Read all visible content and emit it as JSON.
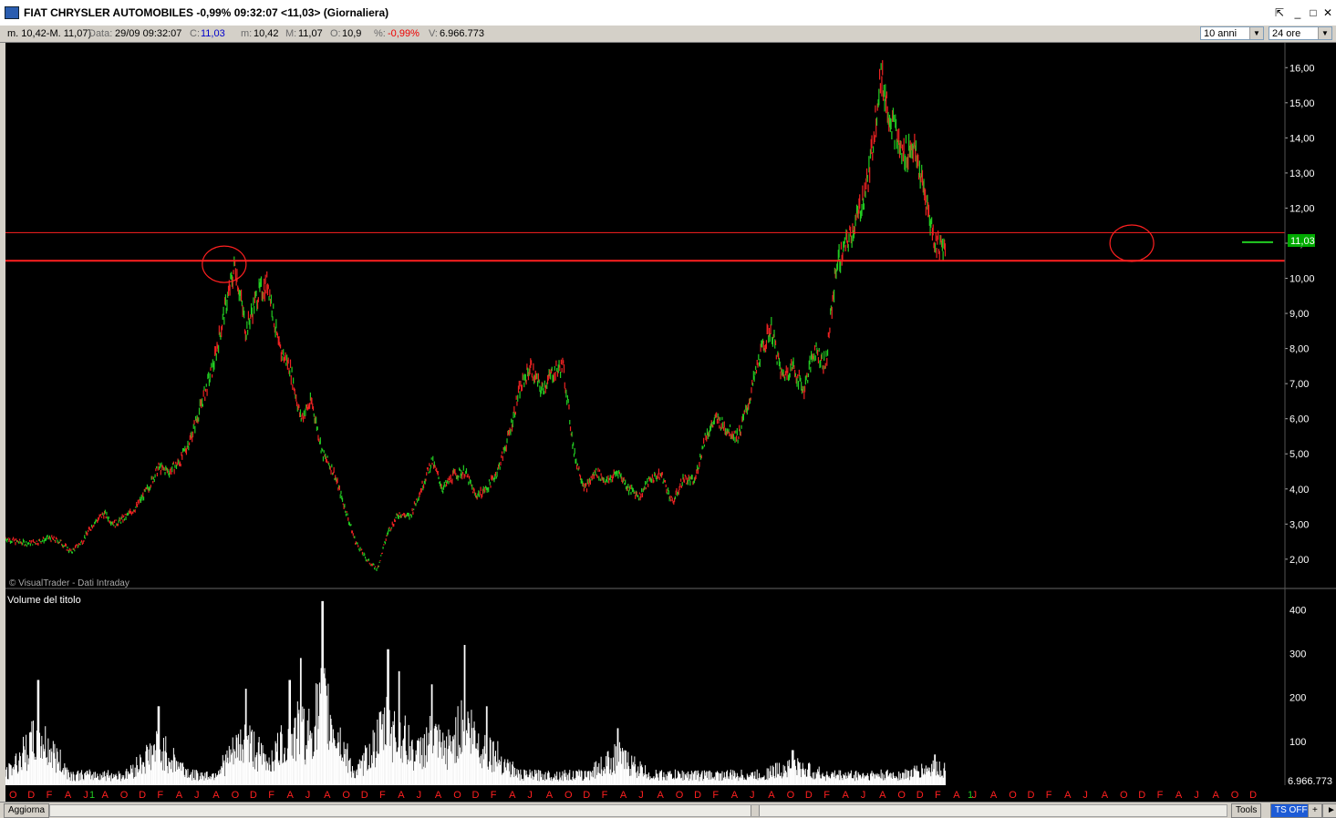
{
  "window": {
    "title": "FIAT CHRYSLER AUTOMOBILES -0,99% 09:32:07  <11,03> (Giornaliera)",
    "minimize_glyph": "_",
    "maximize_glyph": "□",
    "close_glyph": "✕",
    "restore_glyph": "⇱"
  },
  "infobar": {
    "range": "m. 10,42-M. 11,07)",
    "data_label": "Data:",
    "data_value": "29/09 09:32:07",
    "c_label": "C:",
    "c_value": "11,03",
    "m_label": "m:",
    "m_value": "10,42",
    "M_label": "M:",
    "M_value": "11,07",
    "o_label": "O:",
    "o_value": "10,9",
    "pct_label": "%:",
    "pct_value": "-0,99%",
    "v_label": "V:",
    "v_value": "6.966.773",
    "period_select": "10 anni",
    "interval_select": "24 ore"
  },
  "statusbar": {
    "refresh_button": "Aggiorna",
    "tools_button": "Tools",
    "ts_button": "TS OFF",
    "plus_button": "+"
  },
  "colors": {
    "up": "#22cc22",
    "down": "#ee2222",
    "hline": "#ff2020",
    "axis_text": "#ffffff",
    "month_text": "#ff2020",
    "year_text": "#22cc22",
    "last_price_bg": "#00aa00"
  },
  "chart_data": [
    {
      "type": "line",
      "name": "price",
      "credit": "© VisualTrader - Dati Intraday",
      "ylim": [
        1.4,
        16.5
      ],
      "yticks": [
        "2,00",
        "3,00",
        "4,00",
        "5,00",
        "6,00",
        "7,00",
        "8,00",
        "9,00",
        "10,00",
        "11,00",
        "12,00",
        "13,00",
        "14,00",
        "15,00",
        "16,00"
      ],
      "ytick_values": [
        2,
        3,
        4,
        5,
        6,
        7,
        8,
        9,
        10,
        11,
        12,
        13,
        14,
        15,
        16
      ],
      "last_price_label": "11,03",
      "last_price": 11.03,
      "horizontal_lines": [
        11.3,
        10.5
      ],
      "circled_points": [
        {
          "x": 20,
          "y": 10.4
        },
        {
          "x": 103,
          "y": 11.0
        }
      ],
      "x_months_count": 117,
      "points": [
        [
          0,
          2.6
        ],
        [
          1,
          2.5
        ],
        [
          2,
          2.45
        ],
        [
          3,
          2.5
        ],
        [
          4,
          2.6
        ],
        [
          5,
          2.5
        ],
        [
          6,
          2.2
        ],
        [
          7,
          2.5
        ],
        [
          8,
          3.0
        ],
        [
          9,
          3.3
        ],
        [
          10,
          3.0
        ],
        [
          11,
          3.2
        ],
        [
          12,
          3.5
        ],
        [
          13,
          4.0
        ],
        [
          14,
          4.6
        ],
        [
          15,
          4.5
        ],
        [
          16,
          4.8
        ],
        [
          17,
          5.5
        ],
        [
          18,
          6.5
        ],
        [
          19,
          7.5
        ],
        [
          20,
          9.0
        ],
        [
          21,
          10.4
        ],
        [
          22,
          8.5
        ],
        [
          23,
          9.5
        ],
        [
          24,
          9.9
        ],
        [
          25,
          8.0
        ],
        [
          26,
          7.5
        ],
        [
          27,
          6.0
        ],
        [
          28,
          6.5
        ],
        [
          29,
          5.0
        ],
        [
          30,
          4.5
        ],
        [
          31,
          3.5
        ],
        [
          32,
          2.5
        ],
        [
          33,
          2.0
        ],
        [
          34,
          1.7
        ],
        [
          35,
          2.8
        ],
        [
          36,
          3.3
        ],
        [
          37,
          3.2
        ],
        [
          38,
          4.0
        ],
        [
          39,
          4.8
        ],
        [
          40,
          4.0
        ],
        [
          41,
          4.4
        ],
        [
          42,
          4.5
        ],
        [
          43,
          3.8
        ],
        [
          44,
          4.0
        ],
        [
          45,
          4.5
        ],
        [
          46,
          5.5
        ],
        [
          47,
          6.8
        ],
        [
          48,
          7.5
        ],
        [
          49,
          6.8
        ],
        [
          50,
          7.3
        ],
        [
          51,
          7.5
        ],
        [
          52,
          5.0
        ],
        [
          53,
          4.0
        ],
        [
          54,
          4.5
        ],
        [
          55,
          4.2
        ],
        [
          56,
          4.5
        ],
        [
          57,
          4.0
        ],
        [
          58,
          3.8
        ],
        [
          59,
          4.3
        ],
        [
          60,
          4.4
        ],
        [
          61,
          3.6
        ],
        [
          62,
          4.3
        ],
        [
          63,
          4.2
        ],
        [
          64,
          5.5
        ],
        [
          65,
          6.0
        ],
        [
          66,
          5.7
        ],
        [
          67,
          5.5
        ],
        [
          68,
          6.5
        ],
        [
          69,
          7.8
        ],
        [
          70,
          8.6
        ],
        [
          71,
          7.2
        ],
        [
          72,
          7.5
        ],
        [
          73,
          6.8
        ],
        [
          74,
          8.0
        ],
        [
          75,
          7.5
        ],
        [
          76,
          10.4
        ],
        [
          77,
          11.0
        ],
        [
          78,
          11.8
        ],
        [
          79,
          13.0
        ],
        [
          80,
          15.8
        ],
        [
          81,
          14.5
        ],
        [
          82,
          13.5
        ],
        [
          83,
          13.8
        ],
        [
          84,
          12.5
        ],
        [
          85,
          11.0
        ],
        [
          86,
          10.9
        ]
      ]
    },
    {
      "type": "bar",
      "name": "volume",
      "label": "Volume del titolo",
      "ylim": [
        0,
        430
      ],
      "yticks": [
        "100",
        "200",
        "300",
        "400"
      ],
      "ytick_values": [
        100,
        200,
        300,
        400
      ],
      "last_volume_label": "6.966.773",
      "peaks": [
        [
          3,
          240
        ],
        [
          14,
          180
        ],
        [
          22,
          220
        ],
        [
          26,
          240
        ],
        [
          27,
          290
        ],
        [
          29,
          420
        ],
        [
          35,
          310
        ],
        [
          36,
          260
        ],
        [
          39,
          230
        ],
        [
          42,
          320
        ],
        [
          44,
          180
        ],
        [
          56,
          130
        ],
        [
          72,
          80
        ],
        [
          85,
          70
        ]
      ]
    }
  ],
  "x_axis": {
    "month_labels": [
      "O",
      "D",
      "F",
      "A",
      "J",
      "A",
      "O",
      "D",
      "F",
      "A",
      "J",
      "A",
      "O",
      "D",
      "F",
      "A",
      "J",
      "A",
      "O",
      "D",
      "F",
      "A",
      "J",
      "A",
      "O",
      "D",
      "F",
      "A",
      "J",
      "A",
      "O",
      "D",
      "F",
      "A",
      "J",
      "A",
      "O",
      "D",
      "F",
      "A",
      "J",
      "A",
      "O",
      "D",
      "F",
      "A",
      "J",
      "A",
      "O",
      "D",
      "F",
      "A",
      "J",
      "A",
      "O",
      "D",
      "F",
      "A",
      "J",
      "A",
      "O",
      "D",
      "F",
      "A",
      "J",
      "A",
      "O",
      "D"
    ],
    "year_markers": [
      "1",
      "1"
    ]
  }
}
